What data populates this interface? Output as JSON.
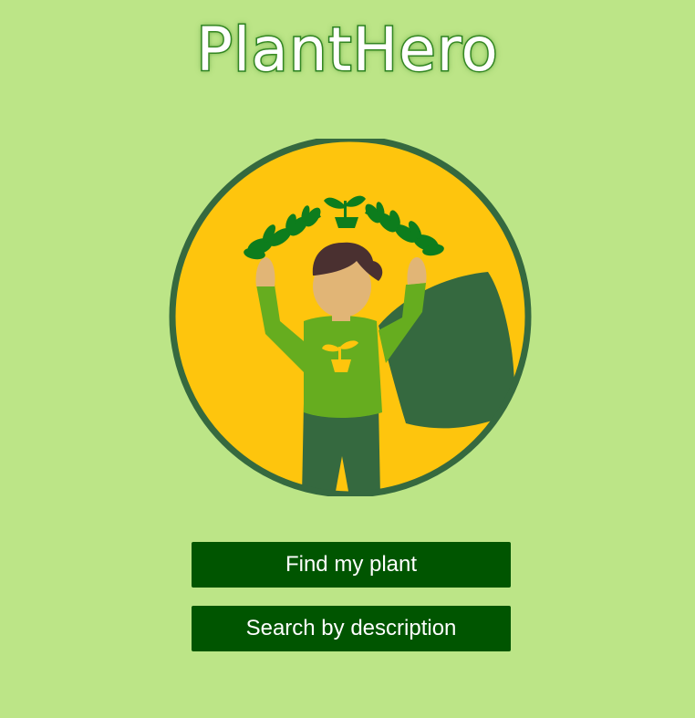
{
  "header": {
    "title": "PlantHero"
  },
  "hero": {
    "icon": "plant-superhero-illustration"
  },
  "actions": {
    "find_label": "Find my plant",
    "search_label": "Search by description"
  },
  "colors": {
    "background": "#bce587",
    "button": "#005500",
    "circle_fill": "#fec50d",
    "circle_border": "#35693f",
    "shirt": "#66ad1f",
    "cape": "#35693f"
  }
}
